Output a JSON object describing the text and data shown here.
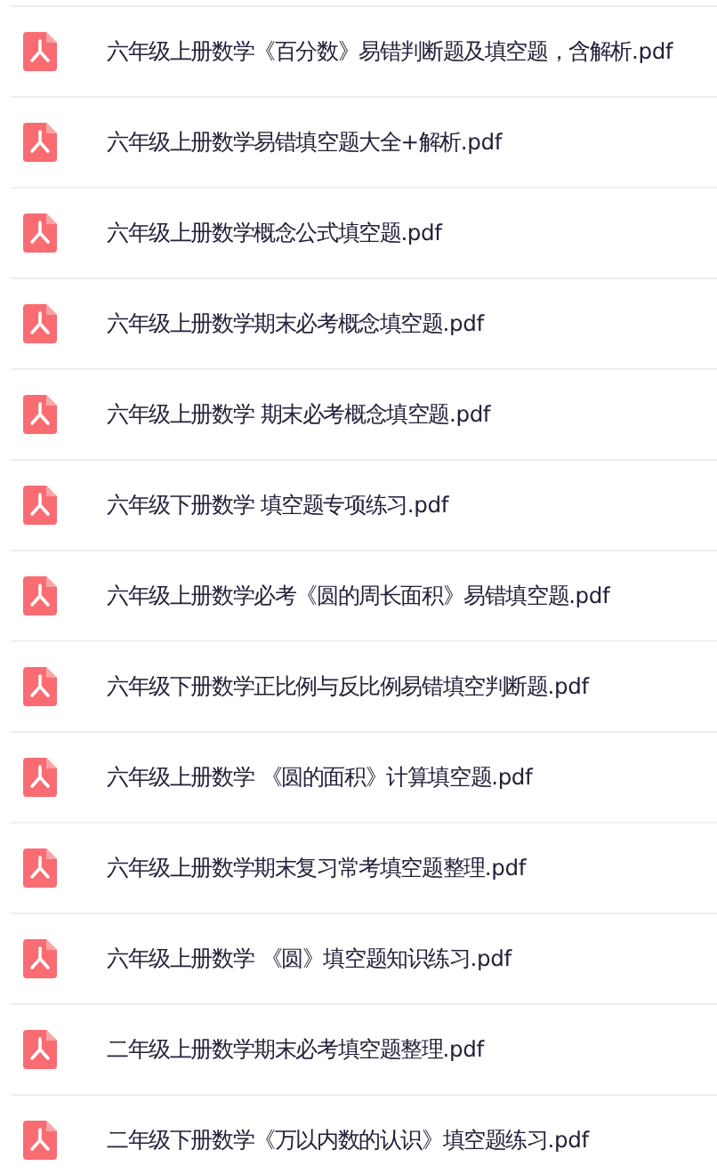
{
  "files": [
    {
      "name": "六年级上册数学《百分数》易错判断题及填空题，含解析.pdf"
    },
    {
      "name": "六年级上册数学易错填空题大全+解析.pdf"
    },
    {
      "name": "六年级上册数学概念公式填空题.pdf"
    },
    {
      "name": "六年级上册数学期末必考概念填空题.pdf"
    },
    {
      "name": "六年级上册数学 期末必考概念填空题.pdf"
    },
    {
      "name": "六年级下册数学 填空题专项练习.pdf"
    },
    {
      "name": "六年级上册数学必考《圆的周长面积》易错填空题.pdf"
    },
    {
      "name": "六年级下册数学正比例与反比例易错填空判断题.pdf"
    },
    {
      "name": "六年级上册数学 《圆的面积》计算填空题.pdf"
    },
    {
      "name": "六年级上册数学期末复习常考填空题整理.pdf"
    },
    {
      "name": "六年级上册数学 《圆》填空题知识练习.pdf"
    },
    {
      "name": "二年级上册数学期末必考填空题整理.pdf"
    },
    {
      "name": "二年级下册数学《万以内数的认识》填空题练习.pdf"
    }
  ]
}
